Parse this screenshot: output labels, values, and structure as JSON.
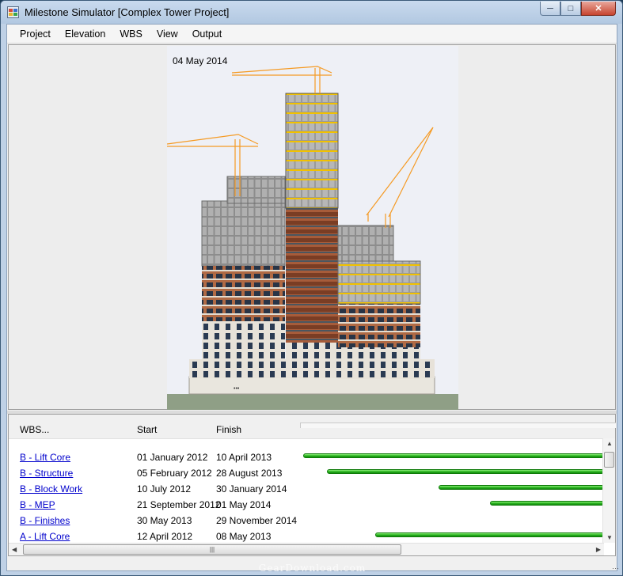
{
  "window": {
    "title": "Milestone Simulator [Complex Tower Project]"
  },
  "menu": [
    "Project",
    "Elevation",
    "WBS",
    "View",
    "Output"
  ],
  "viewer": {
    "date_label": "04 May 2014"
  },
  "table": {
    "headers": {
      "wbs": "WBS...",
      "start": "Start",
      "finish": "Finish"
    },
    "rows": [
      {
        "wbs": "B - Lift Core",
        "start": "01 January 2012",
        "finish": "10 April 2013",
        "bar_start": 0.0,
        "bar_end": 1.0
      },
      {
        "wbs": "B - Structure",
        "start": "05 February 2012",
        "finish": "28 August 2013",
        "bar_start": 0.08,
        "bar_end": 1.0
      },
      {
        "wbs": "B - Block Work",
        "start": "10 July 2012",
        "finish": "30 January 2014",
        "bar_start": 0.45,
        "bar_end": 1.0
      },
      {
        "wbs": "B - MEP",
        "start": "21 September 2012",
        "finish": "01 May 2014",
        "bar_start": 0.62,
        "bar_end": 1.0
      },
      {
        "wbs": "B - Finishes",
        "start": "30 May 2013",
        "finish": "29 November 2014",
        "bar_start": null,
        "bar_end": null
      },
      {
        "wbs": "A - Lift Core",
        "start": "12 April 2012",
        "finish": "08 May 2013",
        "bar_start": 0.24,
        "bar_end": 1.0
      }
    ]
  },
  "watermark": "GearDownload.com",
  "colors": {
    "bar_green": "#26b11c",
    "link_blue": "#0000cc",
    "crane_orange": "#f59a23",
    "facade_brick": "#b06a45"
  },
  "icons": {
    "app": "app-icon",
    "minimize": "minimize-icon",
    "maximize": "maximize-icon",
    "close": "close-icon"
  }
}
